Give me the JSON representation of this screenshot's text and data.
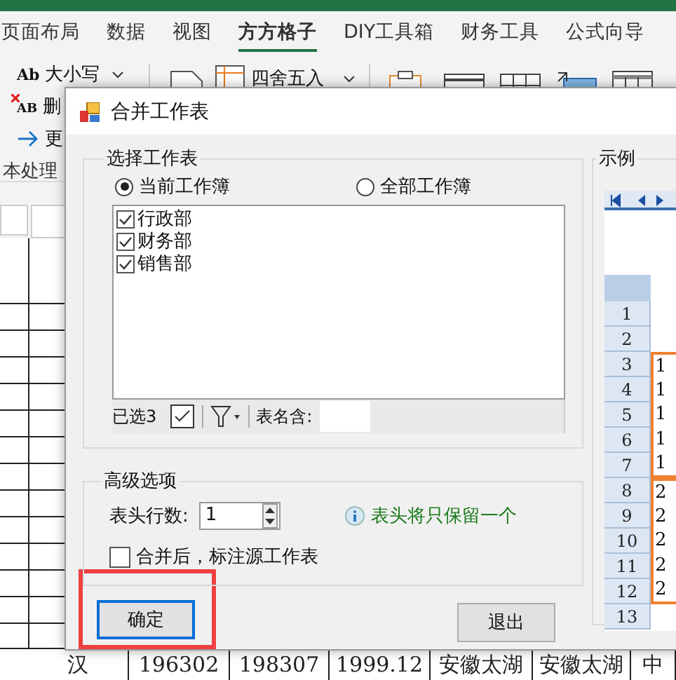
{
  "ribbon_tabs": [
    {
      "label": "页面布局",
      "selected": false
    },
    {
      "label": "数据",
      "selected": false
    },
    {
      "label": "视图",
      "selected": false
    },
    {
      "label": "方方格子",
      "selected": true
    },
    {
      "label": "DIY工具箱",
      "selected": false
    },
    {
      "label": "财务工具",
      "selected": false
    },
    {
      "label": "公式向导",
      "selected": false
    }
  ],
  "text_tools": [
    {
      "icon_text": "Ab",
      "label": "大小写",
      "dropdown": true,
      "kind": "case"
    },
    {
      "icon_text": "AB",
      "label": "删",
      "dropdown": false,
      "kind": "delete"
    },
    {
      "label": "更",
      "dropdown": false,
      "kind": "more"
    }
  ],
  "round_button": {
    "label": "四舍五入",
    "dropdown": true
  },
  "group_label": "本处理",
  "sheet_row": [
    "汉",
    "196302",
    "198307",
    "1999.12",
    "安徽太湖",
    "安徽太湖",
    "中"
  ],
  "dialog": {
    "title": "合并工作表",
    "sheet_group": {
      "title": "选择工作表",
      "scopes": [
        {
          "label": "当前工作簿",
          "selected": true
        },
        {
          "label": "全部工作簿",
          "selected": false
        }
      ],
      "sheets": [
        {
          "name": "行政部",
          "checked": true
        },
        {
          "name": "财务部",
          "checked": true
        },
        {
          "name": "销售部",
          "checked": true
        }
      ],
      "selected_count": "已选3",
      "name_filter_label": "表名含:"
    },
    "advanced": {
      "title": "高级选项",
      "header_rows_label": "表头行数:",
      "header_rows_value": "1",
      "hint": "表头将只保留一个",
      "mark_source": {
        "label": "合并后，标注源工作表",
        "checked": false
      }
    },
    "buttons": [
      {
        "label": "确定",
        "focused": true,
        "highlighted": true
      },
      {
        "label": "退出",
        "focused": false,
        "highlighted": false
      }
    ],
    "example": {
      "title": "示例",
      "sections": [
        {
          "highlighted": false,
          "rows": [
            {
              "number": "1"
            },
            {
              "number": "2"
            }
          ]
        },
        {
          "highlighted": true,
          "rows": [
            {
              "number": "3",
              "value": "1"
            },
            {
              "number": "4",
              "value": "1"
            },
            {
              "number": "5",
              "value": "1"
            },
            {
              "number": "6",
              "value": "1"
            },
            {
              "number": "7",
              "value": "1"
            }
          ]
        },
        {
          "highlighted": true,
          "rows": [
            {
              "number": "8",
              "value": "2"
            },
            {
              "number": "9",
              "value": "2"
            },
            {
              "number": "10",
              "value": "2"
            },
            {
              "number": "11",
              "value": "2"
            },
            {
              "number": "12",
              "value": "2"
            }
          ]
        },
        {
          "highlighted": false,
          "rows": [
            {
              "number": "13"
            }
          ]
        }
      ]
    }
  }
}
